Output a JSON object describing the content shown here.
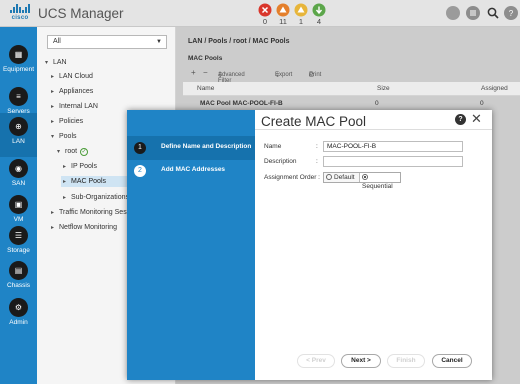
{
  "app": {
    "brand": "cisco",
    "title": "UCS Manager"
  },
  "faults": [
    {
      "count": "0",
      "color": "#d9362b",
      "icon": "critical-x-icon"
    },
    {
      "count": "11",
      "color": "#e47f2b",
      "icon": "major-triangle-icon"
    },
    {
      "count": "1",
      "color": "#e7b53a",
      "icon": "minor-triangle-icon"
    },
    {
      "count": "4",
      "color": "#5ca64a",
      "icon": "warning-down-icon"
    }
  ],
  "nav": [
    {
      "label": "Equipment"
    },
    {
      "label": "Servers"
    },
    {
      "label": "LAN"
    },
    {
      "label": "SAN"
    },
    {
      "label": "VM"
    },
    {
      "label": "Storage"
    },
    {
      "label": "Chassis"
    },
    {
      "label": "Admin"
    }
  ],
  "filter": {
    "value": "All"
  },
  "tree": {
    "lan": "LAN",
    "lan_cloud": "LAN Cloud",
    "appliances": "Appliances",
    "internal_lan": "Internal LAN",
    "policies": "Policies",
    "pools": "Pools",
    "root": "root",
    "ip_pools": "IP Pools",
    "mac_pools": "MAC Pools",
    "sub_orgs": "Sub-Organizations",
    "traffic": "Traffic Monitoring Sessions",
    "netflow": "Netflow Monitoring"
  },
  "breadcrumb": "LAN / Pools / root / MAC Pools",
  "tab": "MAC Pools",
  "toolbar": {
    "add": "+",
    "remove": "−",
    "filter": "Advanced Filter",
    "export": "Export",
    "print": "Print"
  },
  "table": {
    "headers": [
      "Name",
      "Size",
      "Assigned"
    ],
    "rows": [
      [
        "MAC Pool MAC-POOL-FI-B",
        "0",
        "0"
      ]
    ]
  },
  "dialog": {
    "title": "Create MAC Pool",
    "steps": [
      {
        "num": "1",
        "label": "Define Name and Description"
      },
      {
        "num": "2",
        "label": "Add MAC Addresses"
      }
    ],
    "name_label": "Name",
    "name_value": "MAC-POOL-FI-B",
    "desc_label": "Description",
    "desc_value": "",
    "order_label": "Assignment Order :",
    "order_options": [
      "Default",
      "Sequential"
    ],
    "order_selected": "Sequential",
    "colon": ":",
    "buttons": {
      "prev": "< Prev",
      "next": "Next >",
      "finish": "Finish",
      "cancel": "Cancel"
    }
  },
  "accent": "#1f84c6"
}
